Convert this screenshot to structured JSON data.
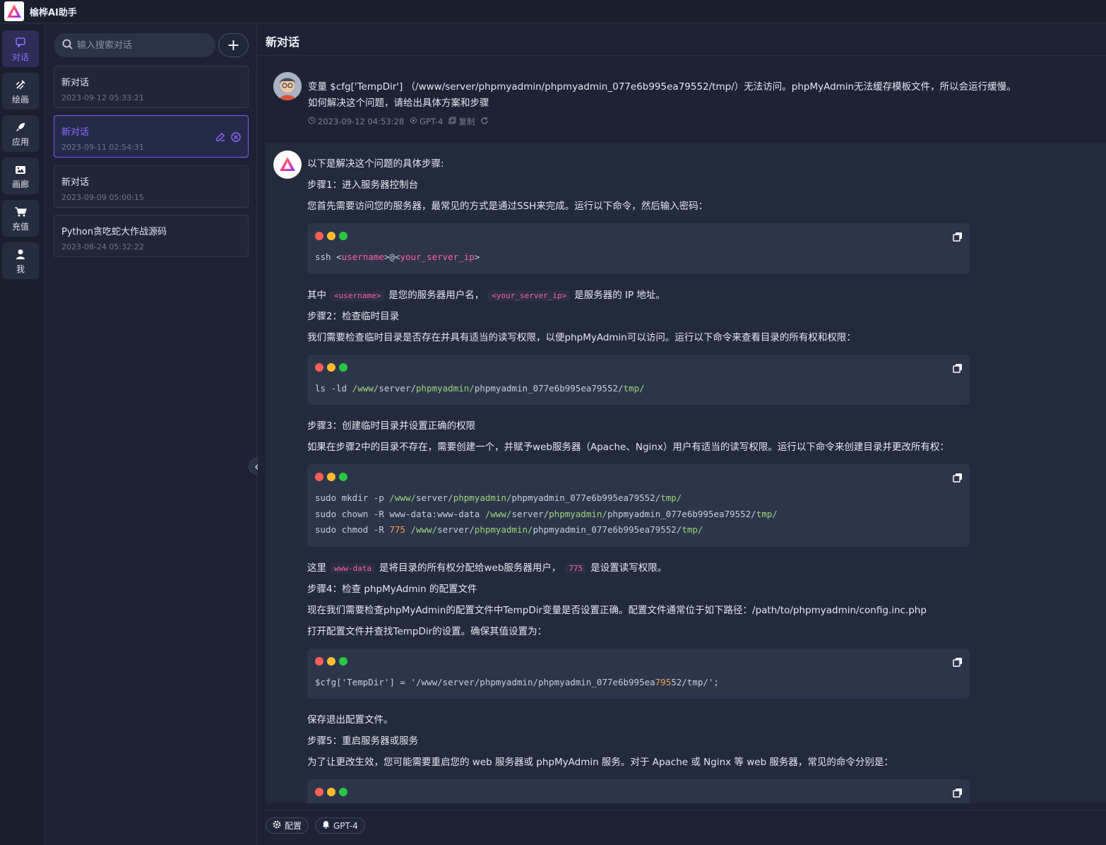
{
  "app": {
    "title": "榆桦AI助手"
  },
  "rail": [
    {
      "label": "对话",
      "icon": "chat-icon"
    },
    {
      "label": "绘画",
      "icon": "brush-icon"
    },
    {
      "label": "应用",
      "icon": "rocket-icon"
    },
    {
      "label": "画廊",
      "icon": "gallery-icon"
    },
    {
      "label": "充值",
      "icon": "cart-icon"
    },
    {
      "label": "我",
      "icon": "user-icon"
    }
  ],
  "sidebar": {
    "search_placeholder": "输入搜索对话",
    "conversations": [
      {
        "title": "新对话",
        "date": "2023-09-12 05:33:21"
      },
      {
        "title": "新对话",
        "date": "2023-09-11 02:54:31"
      },
      {
        "title": "新对话",
        "date": "2023-09-09 05:00:15"
      },
      {
        "title": "Python贪吃蛇大作战源码",
        "date": "2023-08-24 05:32:22"
      }
    ]
  },
  "main": {
    "title": "新对话",
    "user_message": {
      "line1": "变量 $cfg['TempDir'] （/www/server/phpmyadmin/phpmyadmin_077e6b995ea79552/tmp/）无法访问。phpMyAdmin无法缓存模板文件，所以会运行缓慢。",
      "line2": "如何解决这个问题，请给出具体方案和步骤",
      "time": "2023-09-12 04:53:28",
      "model": "GPT-4",
      "copy": "复制"
    },
    "answer": {
      "intro": "以下是解决这个问题的具体步骤:",
      "step1": "步骤1：进入服务器控制台",
      "step1_desc": "您首先需要访问您的服务器，最常见的方式是通过SSH来完成。运行以下命令，然后输入密码：",
      "code1": {
        "a": "ssh <",
        "b": "username",
        "c": ">@<",
        "d": "your_server_ip",
        "e": ">"
      },
      "note1_a": "其中",
      "note1_code1": "<username>",
      "note1_b": "是您的服务器用户名，",
      "note1_code2": "<your_server_ip>",
      "note1_c": "是服务器的 IP 地址。",
      "step2": "步骤2：检查临时目录",
      "step2_desc": "我们需要检查临时目录是否存在并具有适当的读写权限，以便phpMyAdmin可以访问。运行以下命令来查看目录的所有权和权限：",
      "code2": {
        "cmd": "ls -ld ",
        "p1": "/www/",
        "p2": "server/",
        "p3": "phpmyadmin/",
        "p4": "phpmyadmin_077e6b995ea79552/",
        "p5": "tmp/"
      },
      "step3": "步骤3：创建临时目录并设置正确的权限",
      "step3_desc": "如果在步骤2中的目录不存在，需要创建一个，并赋予web服务器（Apache、Nginx）用户有适当的读写权限。运行以下命令来创建目录并更改所有权：",
      "code3": {
        "l1cmd": "sudo mkdir -p ",
        "l2cmd": "sudo chown -R www-data:www-data ",
        "l3cmd": "sudo chmod -R ",
        "l3num": "775",
        "p1": "/www/",
        "p2": "server/",
        "p3": "phpmyadmin/",
        "p4": "phpmyadmin_077e6b995ea79552/",
        "p5": "tmp/"
      },
      "note3_a": "这里",
      "note3_code1": "www-data",
      "note3_b": "是将目录的所有权分配给web服务器用户，",
      "note3_code2": "775",
      "note3_c": "是设置读写权限。",
      "step4": "步骤4：检查 phpMyAdmin 的配置文件",
      "step4_desc": "现在我们需要检查phpMyAdmin的配置文件中TempDir变量是否设置正确。配置文件通常位于如下路径：/path/to/phpmyadmin/config.inc.php",
      "step4_desc2": "打开配置文件并查找TempDir的设置。确保其值设置为：",
      "code4": {
        "a": "$cfg['TempDir'] = '/www/server/phpmyadmin/phpmyadmin_077e6b995ea",
        "b": "795",
        "c": "52/tmp/';"
      },
      "save": "保存退出配置文件。",
      "step5": "步骤5：重启服务器或服务",
      "step5_desc": "为了让更改生效，您可能需要重启您的 web 服务器或 phpMyAdmin 服务。对于 Apache 或 Nginx 等 web 服务器，常见的命令分别是："
    }
  },
  "bottom": {
    "config_label": "配置",
    "model_label": "GPT-4"
  },
  "colors": {
    "accent": "#7a5cff",
    "dot_red": "#ff5f57",
    "dot_yellow": "#febc2e",
    "dot_green": "#28c840"
  }
}
